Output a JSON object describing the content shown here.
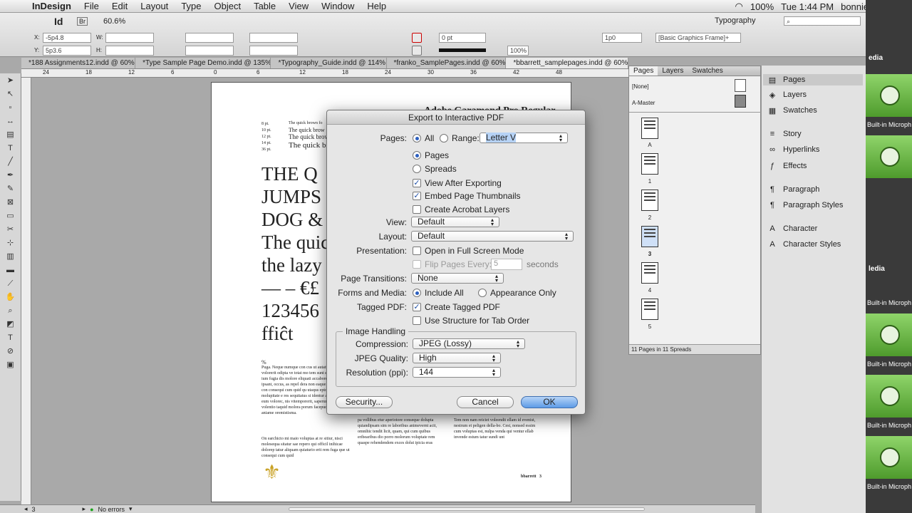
{
  "menubar": {
    "app": "InDesign",
    "items": [
      "File",
      "Edit",
      "Layout",
      "Type",
      "Object",
      "Table",
      "View",
      "Window",
      "Help"
    ],
    "battery": "100%",
    "time": "Tue 1:44 PM",
    "user": "bonniebarrett"
  },
  "control": {
    "zoom": "60.6%",
    "workspace": "Typography",
    "x": "-5p4.8",
    "y": "5p3.6",
    "w_label": "W:",
    "h_label": "H:",
    "stroke": "0 pt",
    "scale": "100%",
    "frame": "1p0",
    "style": "[Basic Graphics Frame]+"
  },
  "tabs": [
    "*188 Assignments12.indd @ 60%",
    "*Type Sample Page Demo.indd @ 135%",
    "*Typography_Guide.indd @ 114%",
    "*franko_SamplePages.indd @ 60%",
    "*bbarrett_samplepages.indd @ 60%"
  ],
  "ruler": [
    "24",
    "18",
    "12",
    "6",
    "0",
    "6",
    "12",
    "18",
    "24",
    "30",
    "36",
    "42",
    "48"
  ],
  "page": {
    "heading": "Adobe Garamond Pro Regular",
    "sizes": [
      "8 pt.",
      "10 pt.",
      "12 pt.",
      "14 pt.",
      "36 pt."
    ],
    "samples": [
      "The quick brown fo",
      "The quick brow",
      "The quick brow",
      "The quick b"
    ],
    "big1": "THE Q",
    "big2": "JUMPS",
    "big3": "DOG &",
    "line4": "The quic",
    "line5": "the lazy",
    "line6": "— – €£",
    "line7": "123456",
    "line8": "ffiĉt",
    "body_left": "Puga. Neque numque con cus ut autatur sequi volorerit odipta ve totat mo tem sunt explatius si ium fugia dis molore eliquati accaborent, a dit ipsant, occus, as repel dera non eaque mola quia con consequi cum quid qu utaqus eptorpid molupitate e res sequitatus si identur audic ducium eum volorec, nis vitemporerit, saperum quunt volentio taquid molora porum facepudae. Ut aniame oremistisma.",
    "body_left2": "On earchicto mi maio voluptas at re sitiur, nisci molesequa sitatur sae repero qui officil inihicae dolorep tatur aliquam quiaturio erit rem fuga que ut consequi cum quid",
    "body_mid": "pa vollibus etur aperiotore conseque dolupta quiandipsam sim re laboribus animevernt acit, omnihic tendit licit, quam, qui cum quibus eribearibus dio porro molorum voluptate rem quaspe rehendendem exces dolut ipicia eras",
    "body_right": "Tem non nam reiciet voleendit ellam id evenist, nestrum et peligen della-bo. Cest, nonsed essim cum voluptas est, nulpa venda qui ventur ellab invende estum tatur sundi unt",
    "footer": "bbarrett   3",
    "pct": "%"
  },
  "status": {
    "page": "3",
    "errors": "No errors"
  },
  "pages_panel": {
    "tabs": [
      "Pages",
      "Layers",
      "Swatches"
    ],
    "none": "[None]",
    "master": "A-Master",
    "labels": [
      "A",
      "1",
      "2",
      "3",
      "4",
      "5"
    ],
    "footer": "11 Pages in 11 Spreads"
  },
  "right_panel": [
    "Pages",
    "Layers",
    "Swatches",
    "Story",
    "Hyperlinks",
    "Effects",
    "Paragraph",
    "Paragraph Styles",
    "Character",
    "Character Styles"
  ],
  "strip": {
    "mic": "Built-in Microph",
    "media": "edia",
    "media2": "ledia"
  },
  "dialog": {
    "title": "Export to Interactive PDF",
    "pages_label": "Pages:",
    "all": "All",
    "range": "Range:",
    "range_value": "Letter V",
    "pages_opt": "Pages",
    "spreads_opt": "Spreads",
    "view_after": "View After Exporting",
    "embed": "Embed Page Thumbnails",
    "acrobat": "Create Acrobat Layers",
    "view_label": "View:",
    "view_value": "Default",
    "layout_label": "Layout:",
    "layout_value": "Default",
    "presentation_label": "Presentation:",
    "fullscreen": "Open in Full Screen Mode",
    "flip": "Flip Pages Every:",
    "flip_value": "5",
    "seconds": "seconds",
    "transitions_label": "Page Transitions:",
    "transitions_value": "None",
    "forms_label": "Forms and Media:",
    "include_all": "Include All",
    "appearance": "Appearance Only",
    "tagged_label": "Tagged PDF:",
    "create_tagged": "Create Tagged PDF",
    "use_structure": "Use Structure for Tab Order",
    "image_handling": "Image Handling",
    "compression_label": "Compression:",
    "compression_value": "JPEG (Lossy)",
    "quality_label": "JPEG Quality:",
    "quality_value": "High",
    "resolution_label": "Resolution (ppi):",
    "resolution_value": "144",
    "security": "Security...",
    "cancel": "Cancel",
    "ok": "OK"
  }
}
